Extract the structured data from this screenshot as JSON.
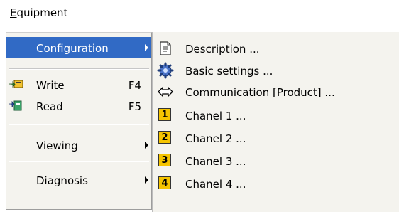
{
  "menubar": {
    "title_first": "E",
    "title_rest": "quipment"
  },
  "main_menu": {
    "items": [
      {
        "label": "Configuration",
        "shortcut": "",
        "selected": true
      },
      {
        "label": "Write",
        "shortcut": "F4"
      },
      {
        "label": "Read",
        "shortcut": "F5"
      },
      {
        "label": "Viewing",
        "shortcut": ""
      },
      {
        "label": "Diagnosis",
        "shortcut": ""
      }
    ]
  },
  "submenu": {
    "items": [
      {
        "label": "Description ...",
        "icon": "document-icon"
      },
      {
        "label": "Basic settings ...",
        "icon": "gear-icon"
      },
      {
        "label": "Communication [Product] ...",
        "icon": "double-arrow-icon"
      },
      {
        "label": "Chanel 1 ...",
        "icon": "number-1-icon",
        "badge": "1"
      },
      {
        "label": "Chanel 2 ...",
        "icon": "number-2-icon",
        "badge": "2"
      },
      {
        "label": "Chanel 3 ...",
        "icon": "number-3-icon",
        "badge": "3"
      },
      {
        "label": "Chanel 4 ...",
        "icon": "number-4-icon",
        "badge": "4"
      }
    ]
  },
  "colors": {
    "selection": "#316ac5",
    "menu_bg": "#f4f3ee",
    "badge": "#f5c400"
  }
}
